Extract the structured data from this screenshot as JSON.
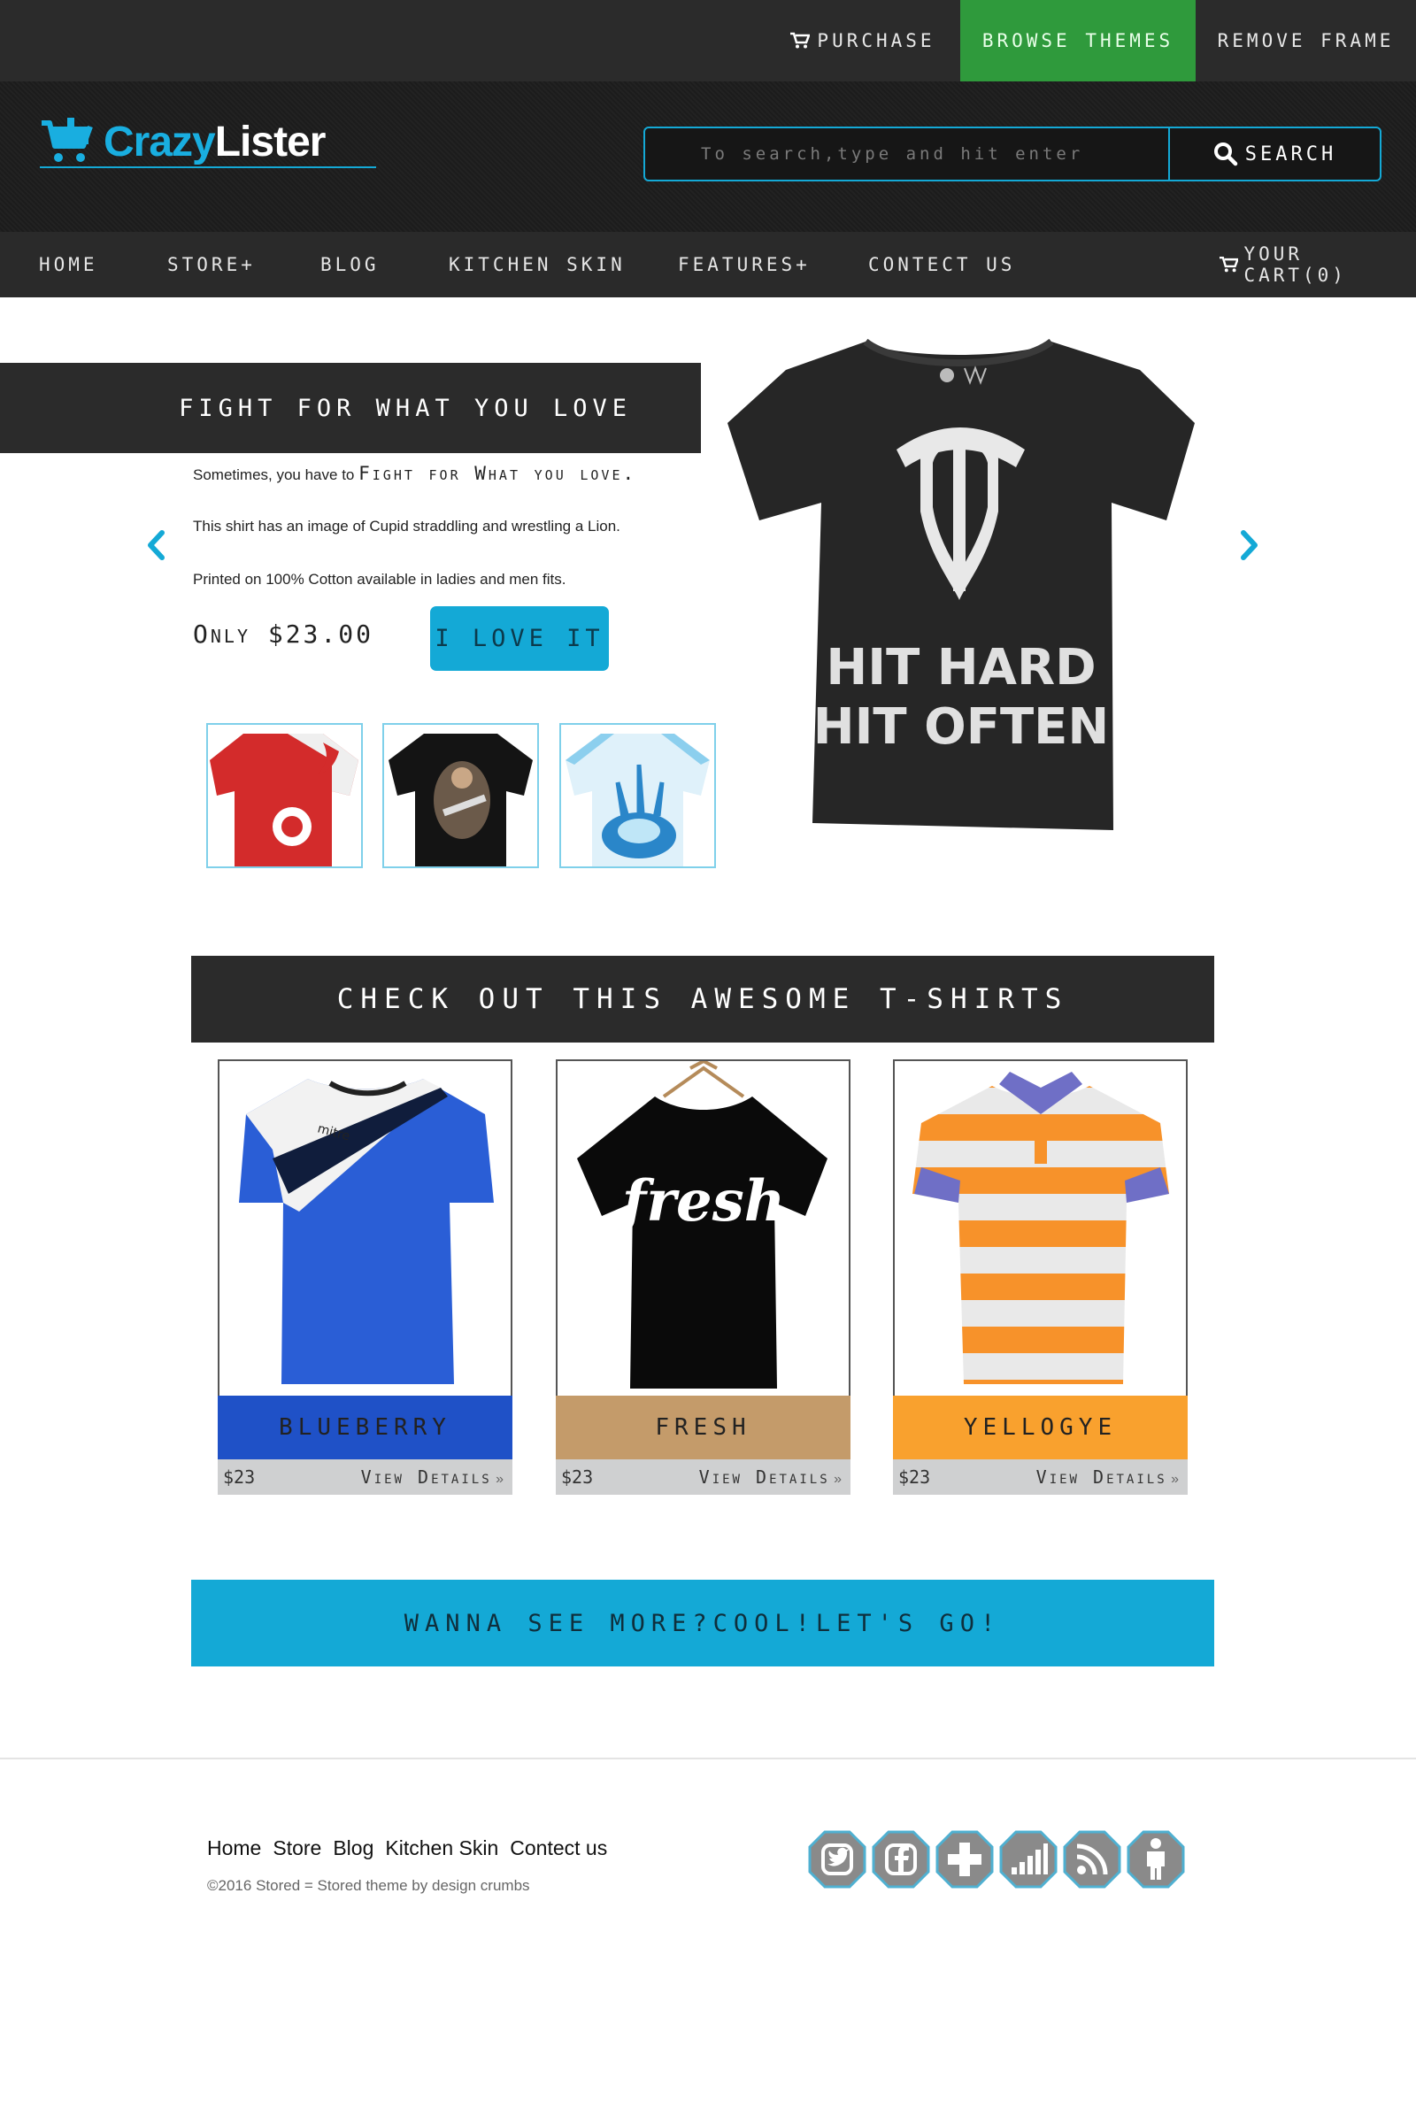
{
  "topbar": {
    "purchase": "PURCHASE",
    "browse_themes": "BROWSE THEMES",
    "remove_frame": "REMOVE FRAME"
  },
  "header": {
    "logo_part1": "Crazy",
    "logo_part2": "Lister",
    "search_placeholder": "To search,type and hit enter",
    "search_button": "SEARCH"
  },
  "nav": {
    "items": [
      "HOME",
      "STORE+",
      "BLOG",
      "KITCHEN SKIN",
      "FEATURES+",
      "CONTECT US"
    ],
    "cart": "YOUR CART(0)"
  },
  "hero": {
    "title": "FIGHT FOR WHAT YOU LOVE",
    "line1_prefix": "Sometimes, you have to",
    "line1_fancy": "Fight for What you love.",
    "line2": "This shirt has an image of Cupid straddling and wrestling a Lion.",
    "line3": "Printed on 100% Cotton available in ladies and men fits.",
    "price": "Only $23.00",
    "cta": "I LOVE IT",
    "shirt_print_line1": "HIT HARD",
    "shirt_print_line2": "HIT OFTEN"
  },
  "products": {
    "title": "CHECK OUT THIS AWESOME T-SHIRTS",
    "items": [
      {
        "name": "BLUEBERRY",
        "price": "$23",
        "details": "View Details",
        "color": "#1f51c7"
      },
      {
        "name": "FRESH",
        "price": "$23",
        "details": "View Details",
        "color": "#c49b6a",
        "print": "fresh"
      },
      {
        "name": "YELLOGYE",
        "price": "$23",
        "details": "View Details",
        "color": "#f9a12e"
      }
    ]
  },
  "more_button": "WANNA SEE MORE?COOL!LET'S GO!",
  "footer": {
    "links": [
      "Home",
      "Store",
      "Blog",
      "Kitchen Skin",
      "Contect us"
    ],
    "copyright": "©2016 Stored = Stored theme by design crumbs",
    "social_icons": [
      "twitter-icon",
      "facebook-icon",
      "plus-icon",
      "signal-icon",
      "rss-icon",
      "person-icon"
    ]
  },
  "colors": {
    "accent": "#14a9d6",
    "dark": "#2b2b2b",
    "green": "#2f9a3c"
  }
}
